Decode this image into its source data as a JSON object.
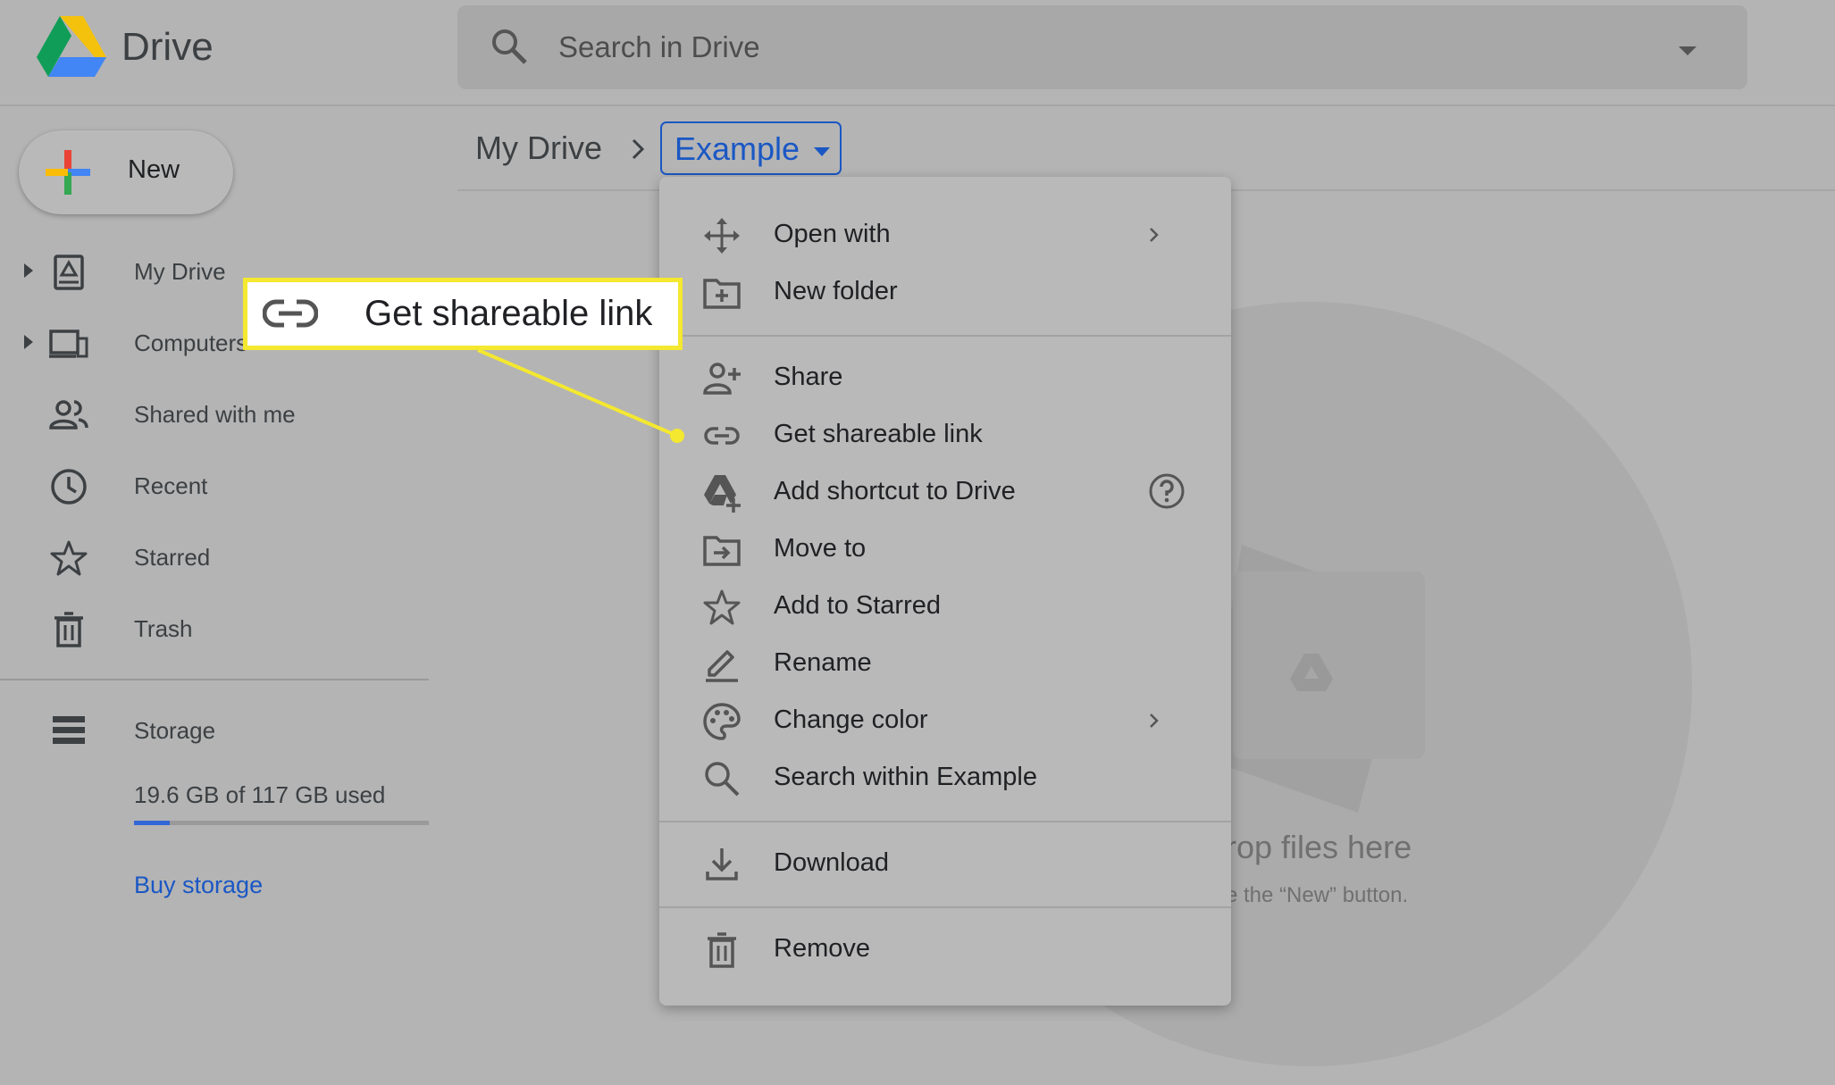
{
  "header": {
    "app_title": "Drive",
    "search_placeholder": "Search in Drive"
  },
  "sidebar": {
    "new_label": "New",
    "items": [
      {
        "label": "My Drive",
        "icon": "my-drive-icon",
        "expandable": true
      },
      {
        "label": "Computers",
        "icon": "computers-icon",
        "expandable": true
      },
      {
        "label": "Shared with me",
        "icon": "shared-with-me-icon",
        "expandable": false
      },
      {
        "label": "Recent",
        "icon": "clock-icon",
        "expandable": false
      },
      {
        "label": "Starred",
        "icon": "star-icon",
        "expandable": false
      },
      {
        "label": "Trash",
        "icon": "trash-icon",
        "expandable": false
      }
    ],
    "storage": {
      "label": "Storage",
      "usage_text": "19.6 GB of 117 GB used",
      "used_fraction": 0.12,
      "buy_label": "Buy storage"
    }
  },
  "breadcrumb": {
    "root": "My Drive",
    "current": "Example"
  },
  "empty_state": {
    "title": "rop files here",
    "subtitle": "e the “New” button."
  },
  "context_menu": {
    "items": [
      {
        "label": "Open with",
        "icon": "open-with-icon",
        "submenu": true
      },
      {
        "label": "New folder",
        "icon": "new-folder-icon"
      },
      {
        "label": "Share",
        "icon": "share-person-add-icon"
      },
      {
        "label": "Get shareable link",
        "icon": "link-icon"
      },
      {
        "label": "Add shortcut to Drive",
        "icon": "add-shortcut-drive-icon",
        "help": true
      },
      {
        "label": "Move to",
        "icon": "move-to-folder-icon"
      },
      {
        "label": "Add to Starred",
        "icon": "star-icon"
      },
      {
        "label": "Rename",
        "icon": "pencil-icon"
      },
      {
        "label": "Change color",
        "icon": "palette-icon",
        "submenu": true
      },
      {
        "label": "Search within Example",
        "icon": "search-icon"
      },
      {
        "label": "Download",
        "icon": "download-icon"
      },
      {
        "label": "Remove",
        "icon": "trash-icon"
      }
    ]
  },
  "callout": {
    "label": "Get shareable link",
    "icon": "link-icon",
    "color": "#f4e830"
  },
  "colors": {
    "accent_blue": "#1a57c4",
    "highlight_yellow": "#f4e830"
  }
}
